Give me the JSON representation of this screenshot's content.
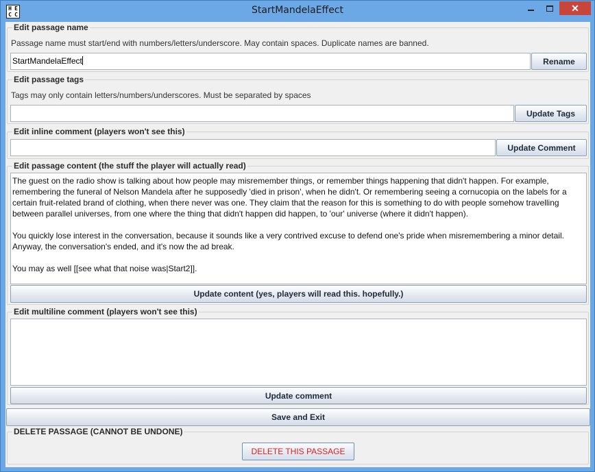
{
  "window": {
    "title": "StartMandelaEffect",
    "icon_letters": [
      "H",
      "E",
      "C",
      "C"
    ],
    "minimize_icon": "minimize-icon",
    "maximize_icon": "maximize-icon",
    "close_label": "✕"
  },
  "passage_name": {
    "legend": "Edit passage name",
    "hint": "Passage name must start/end with numbers/letters/underscore. May contain spaces. Duplicate names are banned.",
    "value": "StartMandelaEffect",
    "button": "Rename"
  },
  "passage_tags": {
    "legend": "Edit passage tags",
    "hint": "Tags may only contain letters/numbers/underscores. Must be separated by spaces",
    "value": "",
    "button": "Update Tags"
  },
  "inline_comment": {
    "legend": "Edit inline comment (players won't see this)",
    "value": "",
    "button": "Update Comment"
  },
  "passage_content": {
    "legend": "Edit passage content (the stuff the player will actually read)",
    "value": "The guest on the radio show is talking about how people may misremember things, or remember things happening that didn't happen. For example, remembering the funeral of Nelson Mandela after he supposedly 'died in prison', when he didn't. Or remembering seeing a cornucopia on the labels for a certain fruit-related brand of clothing, when there never was one. They claim that the reason for this is something to do with people somehow travelling between parallel universes, from one where the thing that didn't happen did happen, to 'our' universe (where it didn't happen).\n\nYou quickly lose interest in the conversation, because it sounds like a very contrived excuse to defend one's pride when misremembering a minor detail. Anyway, the conversation's ended, and it's now the ad break.\n\nYou may as well [[see what that noise was|Start2]].",
    "button": "Update content (yes, players will read this. hopefully.)"
  },
  "multiline_comment": {
    "legend": "Edit multiline comment (players won't see this)",
    "value": "",
    "button": "Update comment"
  },
  "save_exit": {
    "button": "Save and Exit"
  },
  "delete": {
    "legend": "DELETE PASSAGE (CANNOT BE UNDONE)",
    "button": "DELETE THIS PASSAGE",
    "button_color": "#e02020"
  }
}
